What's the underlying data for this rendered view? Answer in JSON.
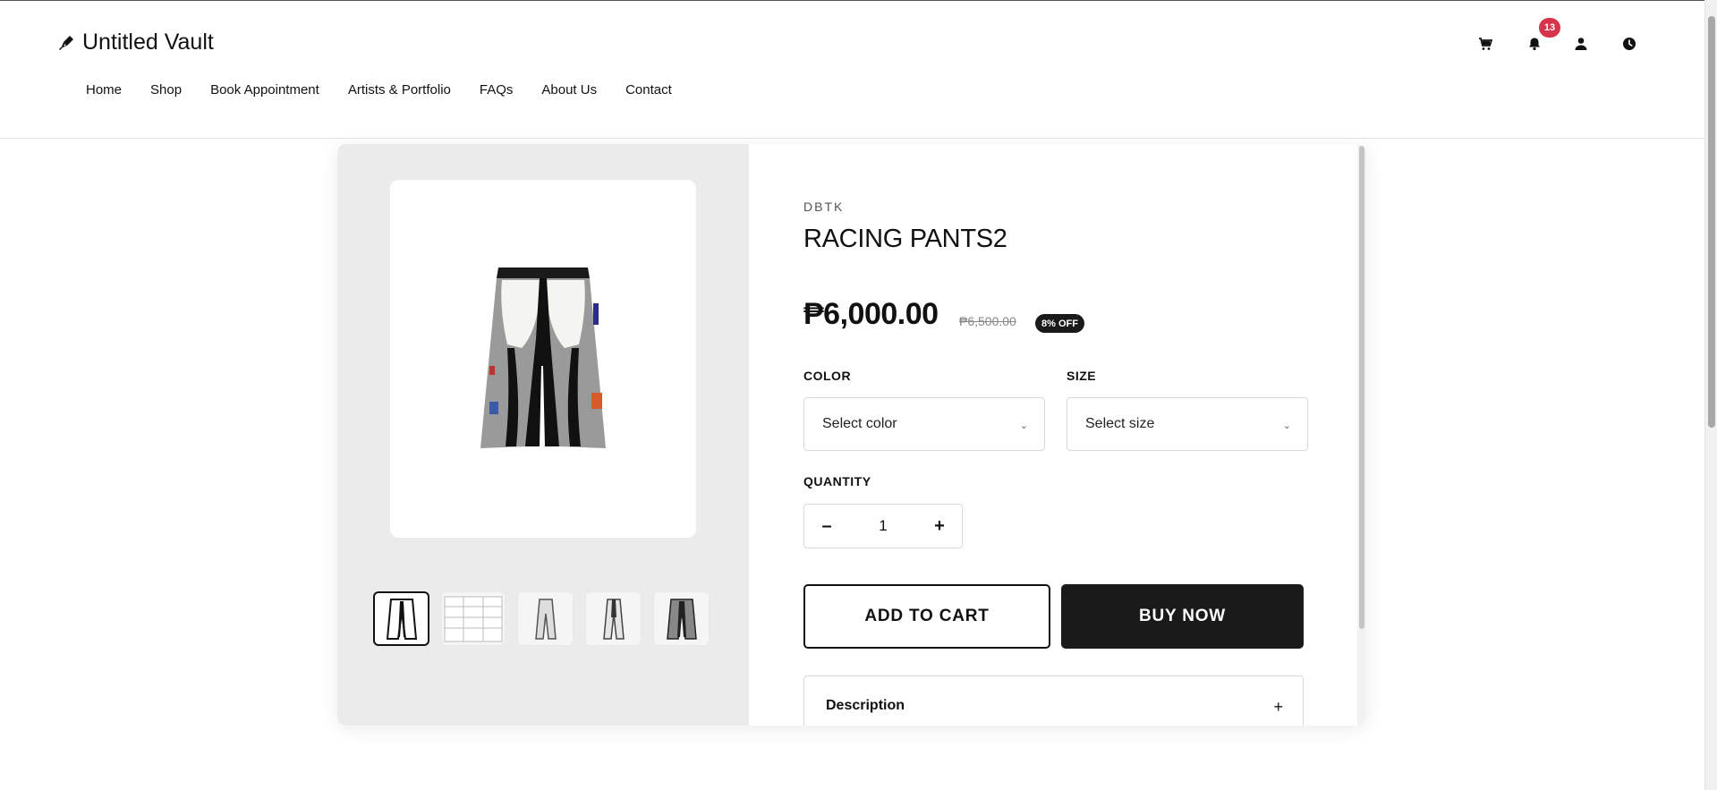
{
  "header": {
    "logo_text": "Untitled Vault",
    "nav": [
      "Home",
      "Shop",
      "Book Appointment",
      "Artists & Portfolio",
      "FAQs",
      "About Us",
      "Contact"
    ],
    "icons": [
      "cart-icon",
      "bell-icon",
      "user-icon",
      "clock-icon"
    ],
    "notification_count": "13"
  },
  "product": {
    "brand": "DBTK",
    "title": "RACING PANTS2",
    "price": "₱6,000.00",
    "old_price": "₱6,500.00",
    "discount": "8% OFF",
    "color_label": "COLOR",
    "color_placeholder": "Select color",
    "size_label": "SIZE",
    "size_placeholder": "Select size",
    "quantity_label": "QUANTITY",
    "quantity": "1",
    "qty_minus": "–",
    "qty_plus": "+",
    "add_to_cart": "ADD TO CART",
    "buy_now": "BUY NOW",
    "description_label": "Description",
    "accordion_toggle": "+"
  },
  "gallery": {
    "thumb_count": 5,
    "active_thumb": 0
  },
  "colors": {
    "accent": "#1a1a1a",
    "badge": "#d6344a",
    "gallery_bg": "#ebebeb"
  }
}
